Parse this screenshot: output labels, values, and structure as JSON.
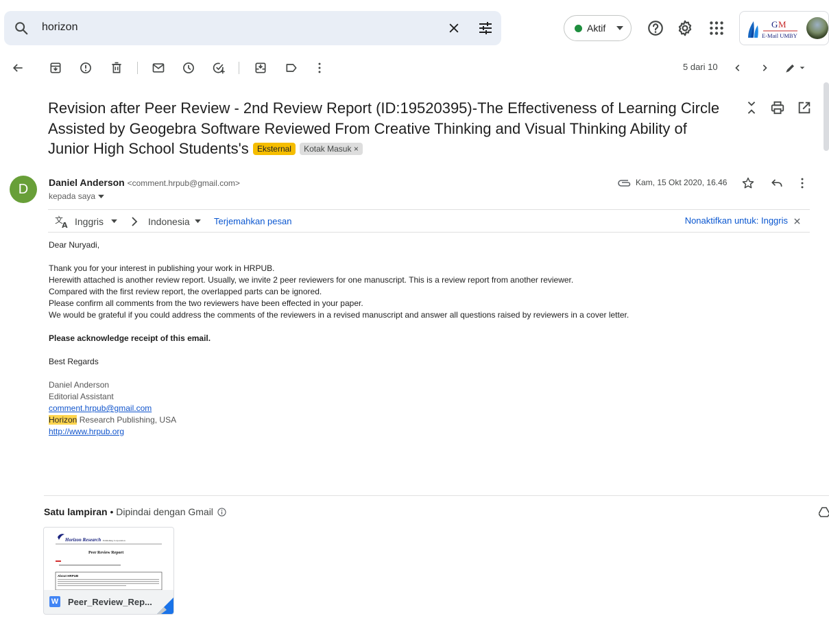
{
  "search": {
    "query": "horizon"
  },
  "status": {
    "label": "Aktif",
    "color": "#1e8e3e"
  },
  "account": {
    "logo_text": "GM",
    "logo_subtext": "E-Mail UMBY"
  },
  "toolbar": {
    "icons": [
      "back-arrow-icon",
      "archive-icon",
      "report-spam-icon",
      "delete-icon",
      "mark-unread-icon",
      "snooze-icon",
      "add-task-icon",
      "move-to-icon",
      "label-icon",
      "more-vert-icon"
    ],
    "pager": "5 dari 10"
  },
  "message": {
    "subject": "Revision after Peer Review - 2nd Review Report (ID:19520395)-The Effectiveness of Learning Circle Assisted by Geogebra Software Reviewed From Creative Thinking and Visual Thinking Ability of Junior High School Students's",
    "labels": {
      "external": "Eksternal",
      "inbox": "Kotak Masuk",
      "inbox_close": "×"
    },
    "sender": {
      "initial": "D",
      "name": "Daniel Anderson",
      "email": "<comment.hrpub@gmail.com>",
      "avatar_color": "#689f38"
    },
    "recipient": "kepada saya",
    "date": "Kam, 15 Okt 2020, 16.46"
  },
  "translate": {
    "from_lang": "Inggris",
    "to_lang": "Indonesia",
    "translate_link": "Terjemahkan pesan",
    "disable_link": "Nonaktifkan untuk: Inggris"
  },
  "body": {
    "greeting": "Dear Nuryadi,",
    "lines": [
      "Thank you for your interest in publishing your work in HRPUB.",
      "Herewith attached is another review report. Usually, we invite 2 peer reviewers for one manuscript. This is a review report from another reviewer.",
      "Compared with the first review report, the overlapped parts can be ignored.",
      "Please confirm all comments from the two reviewers have been effected in your paper.",
      "We would be grateful if you could address the comments of the reviewers in a revised manuscript and answer all questions raised by reviewers in a cover letter."
    ],
    "acknowledge": "Please acknowledge receipt of this email.",
    "regards": "Best Regards",
    "signature": {
      "name": "Daniel Anderson",
      "title": "Editorial Assistant",
      "email": "comment.hrpub@gmail.com",
      "org_highlight": "Horizon",
      "org_rest": " Research Publishing, USA",
      "website": "http://www.hrpub.org"
    }
  },
  "attachments": {
    "count_label": "Satu lampiran",
    "separator": " • ",
    "scan_label": "Dipindai dengan Gmail",
    "file": {
      "name": "Peer_Review_Rep...",
      "type_letter": "W",
      "preview_brand": "Horizon Research",
      "preview_brand_sub": "Publishing Corporation",
      "preview_title": "Peer Review Report",
      "preview_section": "About HRPUB"
    }
  }
}
